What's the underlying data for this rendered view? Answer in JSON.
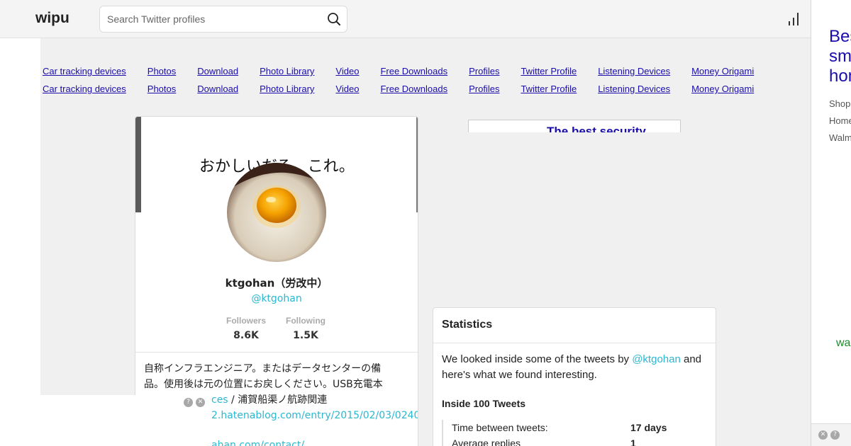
{
  "header": {
    "logo": "wipu",
    "search_placeholder": "Search Twitter profiles"
  },
  "nav": {
    "rows": [
      [
        "Car tracking devices",
        "Photos",
        "Download",
        "Photo Library",
        "Video",
        "Free Downloads",
        "Profiles",
        "Twitter Profile",
        "Listening Devices",
        "Money Origami"
      ],
      [
        "Car tracking devices",
        "Photos",
        "Download",
        "Photo Library",
        "Video",
        "Free Downloads",
        "Profiles",
        "Twitter Profile",
        "Listening Devices",
        "Money Origami"
      ]
    ]
  },
  "right_ad": {
    "title": "Bes sm hom",
    "lines": [
      "Shop",
      "Home",
      "Walm"
    ],
    "green_text": "wa"
  },
  "profile": {
    "banner_text": "おかしいだろ、これ。",
    "name": "ktgohan（労改中）",
    "handle": "@ktgohan",
    "followers_label": "Followers",
    "followers_count": "8.6K",
    "following_label": "Following",
    "following_count": "1.5K",
    "bio_line1": "自称インフラエンジニア。またはデータセンターの備",
    "bio_line2": "品。使用後は元の位置にお戻しください。USB充電本",
    "bio_line3_link": "ces",
    "bio_line3_text": " / 浦賀船渠ノ航跡関連",
    "bio_line4_link": "2.hatenablog.com/entry/2015/02/03/0240",
    "bio_line5_link": "ahan.com/contact/"
  },
  "ad_box": {
    "text": "The best security"
  },
  "statistics": {
    "title": "Statistics",
    "intro_before": "We looked inside some of the tweets by ",
    "intro_handle": "@ktgohan",
    "intro_after": " and here's what we found interesting.",
    "subtitle": "Inside 100 Tweets",
    "rows": [
      {
        "label": "Time between tweets:",
        "value": "17 days"
      },
      {
        "label": "Average replies",
        "value": "1"
      }
    ]
  },
  "controls": {
    "help_glyph": "?",
    "close_glyph": "✕"
  }
}
